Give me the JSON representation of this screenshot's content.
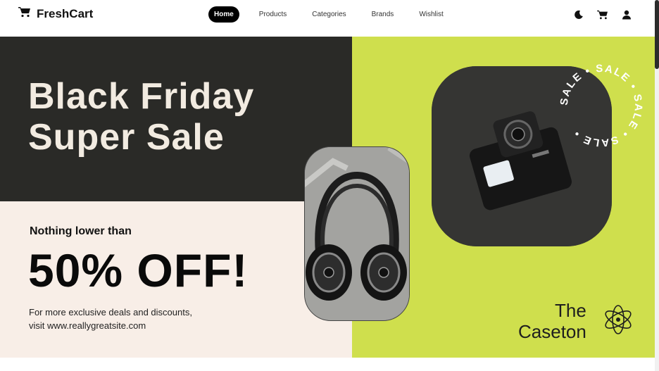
{
  "brand": {
    "name": "FreshCart",
    "icon": "cart-icon"
  },
  "nav": {
    "links": [
      {
        "label": "Home"
      },
      {
        "label": "Products"
      },
      {
        "label": "Categories"
      },
      {
        "label": "Brands"
      },
      {
        "label": "Wishlist"
      }
    ],
    "icons": [
      "moon-icon",
      "cart-icon",
      "user-icon"
    ]
  },
  "banner": {
    "headline_line1": "Black Friday",
    "headline_line2": "Super Sale",
    "tagline": "Nothing lower than",
    "discount": "50% OFF!",
    "blurb_line1": "For more exclusive deals and discounts,",
    "blurb_line2": "visit www.reallygreatsite.com",
    "sale_ring_text": "SALE • SALE • SALE • SALE •",
    "logo_line1": "The",
    "logo_line2": "Caseton",
    "colors": {
      "dark": "#2a2a27",
      "cream": "#f8eee7",
      "lime": "#cfdf4d"
    }
  }
}
